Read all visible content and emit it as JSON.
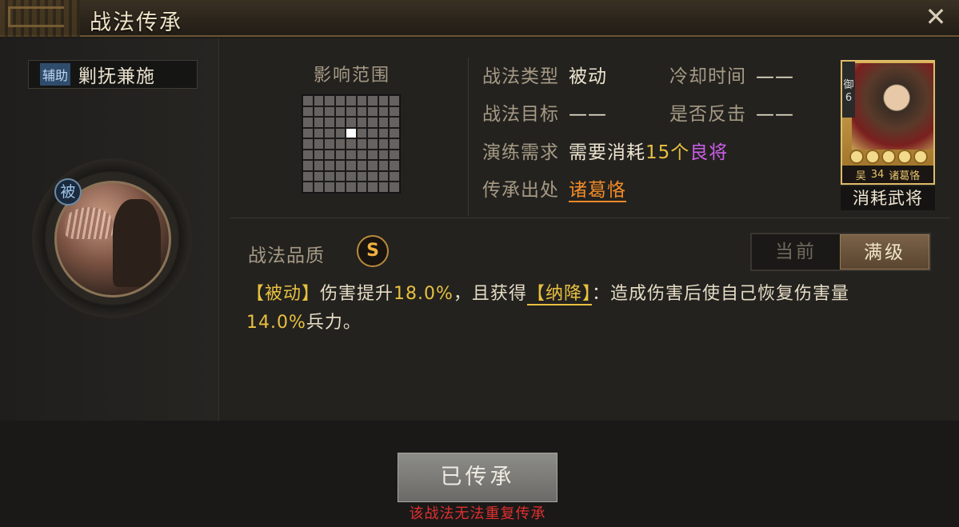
{
  "window": {
    "title": "战法传承",
    "close_icon": "close-icon"
  },
  "skill": {
    "type_tag": "辅助",
    "name": "剿抚兼施",
    "badge": "被",
    "range_label": "影响范围",
    "range_grid": {
      "rows": 9,
      "cols": 9,
      "active_cells": [
        [
          3,
          4
        ]
      ]
    }
  },
  "info": {
    "type_label": "战法类型",
    "type_value": "被动",
    "cooldown_label": "冷却时间",
    "cooldown_value": "——",
    "target_label": "战法目标",
    "target_value": "——",
    "counter_label": "是否反击",
    "counter_value": "——",
    "practice_label": "演练需求",
    "practice_prefix": "需要消耗",
    "practice_count": "15个",
    "practice_item": "良将",
    "source_label": "传承出处",
    "source_value": "诸葛恪"
  },
  "card": {
    "faction": "御",
    "cost": "6",
    "stars": 5,
    "kingdom": "吴",
    "level": "34",
    "general": "诸葛恪",
    "caption": "消耗武将"
  },
  "quality": {
    "label": "战法品质",
    "grade": "S"
  },
  "toggle": {
    "current": "当前",
    "max": "满级",
    "selected": "max"
  },
  "description": {
    "p1": "【被动】",
    "p2": "伤害提升",
    "p3": "18.0%",
    "p4": "，且获得",
    "p5": "【纳降】",
    "p6": "：造成伤害后使自己恢复伤害量",
    "p7": "14.0%",
    "p8": "兵力。"
  },
  "footer": {
    "button": "已传承",
    "warning": "该战法无法重复传承"
  },
  "colors": {
    "accent_yellow": "#e8c040",
    "purple": "#cc5ee8",
    "orange": "#f08a28",
    "warning_red": "#e03030"
  }
}
